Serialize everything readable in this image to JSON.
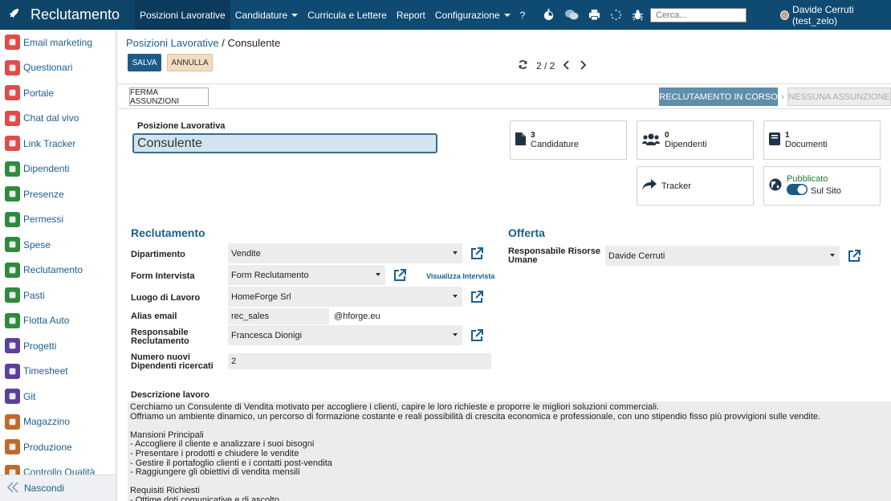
{
  "app": {
    "title": "Reclutamento"
  },
  "menu": {
    "items": [
      {
        "label": "Posizioni Lavorative",
        "active": true,
        "dropdown": false
      },
      {
        "label": "Candidature",
        "active": false,
        "dropdown": true
      },
      {
        "label": "Curricula e Lettere",
        "active": false,
        "dropdown": false
      },
      {
        "label": "Report",
        "active": false,
        "dropdown": false
      },
      {
        "label": "Configurazione",
        "active": false,
        "dropdown": true
      },
      {
        "label": "?",
        "active": false,
        "dropdown": false
      }
    ]
  },
  "search": {
    "placeholder": "Cerca..."
  },
  "user": {
    "name": "Davide Cerruti (test_zelo)"
  },
  "sidebar": {
    "items": [
      {
        "label": "Email marketing",
        "icon": "paper-plane-icon",
        "color": "#e14b4b"
      },
      {
        "label": "Questionari",
        "icon": "clipboard-icon",
        "color": "#e14b4b"
      },
      {
        "label": "Portale",
        "icon": "globe-icon",
        "color": "#e14b4b"
      },
      {
        "label": "Chat dal vivo",
        "icon": "chat-icon",
        "color": "#e14b4b"
      },
      {
        "label": "Link Tracker",
        "icon": "link-icon",
        "color": "#e14b4b"
      },
      {
        "label": "Dipendenti",
        "icon": "users-icon",
        "color": "#2e8b3e"
      },
      {
        "label": "Presenze",
        "icon": "user-check-icon",
        "color": "#2e8b3e"
      },
      {
        "label": "Permessi",
        "icon": "calendar-icon",
        "color": "#2e8b3e"
      },
      {
        "label": "Spese",
        "icon": "dollar-icon",
        "color": "#2e8b3e"
      },
      {
        "label": "Reclutamento",
        "icon": "search-user-icon",
        "color": "#2e8b3e"
      },
      {
        "label": "Pasti",
        "icon": "cutlery-icon",
        "color": "#2e8b3e"
      },
      {
        "label": "Flotta Auto",
        "icon": "car-icon",
        "color": "#2e8b3e"
      },
      {
        "label": "Progetti",
        "icon": "puzzle-icon",
        "color": "#5b3f9e"
      },
      {
        "label": "Timesheet",
        "icon": "clock-icon",
        "color": "#5b3f9e"
      },
      {
        "label": "Git",
        "icon": "git-icon",
        "color": "#5b3f9e"
      },
      {
        "label": "Magazzino",
        "icon": "box-icon",
        "color": "#c0692b"
      },
      {
        "label": "Produzione",
        "icon": "wrench-icon",
        "color": "#c0692b"
      },
      {
        "label": "Controllo Qualità",
        "icon": "quality-icon",
        "color": "#c0692b"
      }
    ],
    "hide_label": "Nascondi"
  },
  "breadcrumb": {
    "parent": "Posizioni Lavorative",
    "separator": "/",
    "current": "Consulente"
  },
  "actions": {
    "save": "SALVA",
    "discard": "ANNULLA"
  },
  "pager": {
    "value": "2 / 2"
  },
  "status": {
    "stop_button": "FERMA ASSUNZIONI",
    "stage_current": "RECLUTAMENTO IN CORSO",
    "stage_next": "NESSUNA ASSUNZIONE"
  },
  "form": {
    "name_label": "Posizione Lavorativa",
    "name_value": "Consulente",
    "smart_buttons": {
      "applications": {
        "count": "3",
        "label": "Candidature"
      },
      "employees": {
        "count": "0",
        "label": "Dipendenti"
      },
      "documents": {
        "count": "1",
        "label": "Documenti"
      },
      "tracker": {
        "label": "Tracker"
      },
      "website": {
        "status": "Pubblicato",
        "label": "Sul Sito"
      }
    },
    "recruitment_title": "Reclutamento",
    "offer_title": "Offerta",
    "fields": {
      "department": {
        "label": "Dipartimento",
        "value": "Vendite"
      },
      "interview_form": {
        "label": "Form Intervista",
        "value": "Form Reclutamento",
        "link": "Visualizza Intervista"
      },
      "work_location": {
        "label": "Luogo di Lavoro",
        "value": "HomeForge Srl"
      },
      "email_alias": {
        "label": "Alias email",
        "value": "rec_sales",
        "domain": "@hforge.eu"
      },
      "recruiter": {
        "label": "Responsabile Reclutamento",
        "value": "Francesca Dionigi"
      },
      "new_employees": {
        "label": "Numero nuovi Dipendenti ricercati",
        "value": "2"
      },
      "hr_responsible": {
        "label": "Responsabile Risorse Umane",
        "value": "Davide Cerruti"
      }
    },
    "description_label": "Descrizione lavoro",
    "description_text": "Cerchiamo un Consulente di Vendita motivato per accogliere i clienti, capire le loro richieste e proporre le migliori soluzioni commerciali.\nOffriamo un ambiente dinamico, un percorso di formazione costante e reali possibilità di crescita economica e professionale, con uno stipendio fisso più provvigioni sulle vendite.\n\nMansioni Principali\n- Accogliere il cliente e analizzare i suoi bisogni\n- Presentare i prodotti e chiudere le vendite\n- Gestire il portafoglio clienti e i contatti post-vendita\n- Raggiungere gli obiettivi di vendita mensili\n\nRequisiti Richiesti\n- Ottime doti comunicative e di ascolto"
  },
  "colors": {
    "navbar": "#0f4a72",
    "primary": "#1c5b88",
    "stage_active": "#5f8eac",
    "link": "#1b5e8f"
  }
}
